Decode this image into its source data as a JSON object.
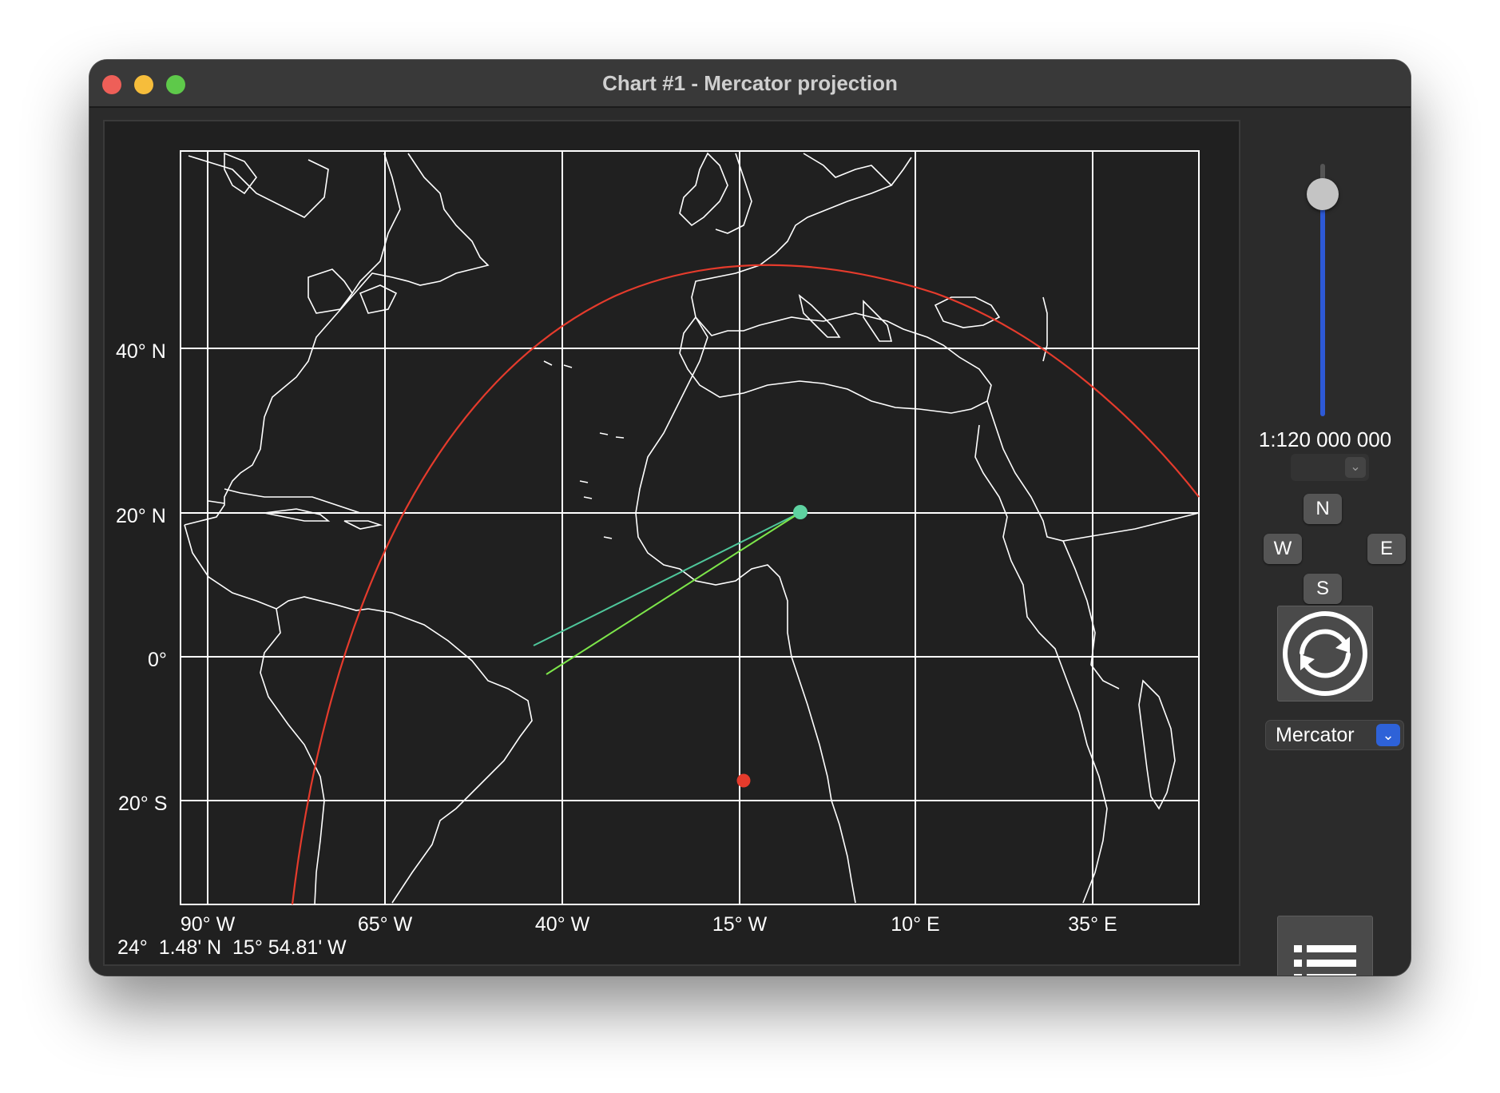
{
  "window": {
    "title": "Chart #1 - Mercator projection"
  },
  "map": {
    "projection": "Mercator",
    "lat_labels": [
      "40° N",
      "20° N",
      "0°",
      "20° S"
    ],
    "lon_labels": [
      "90° W",
      "65° W",
      "40° W",
      "15° W",
      "10° E",
      "35° E"
    ],
    "cursor_readout": "24°  1.48' N  15° 54.81' W",
    "colors": {
      "background": "#202020",
      "coastline": "#ffffff",
      "grid": "#ffffff",
      "great_circle": "#e53b2c",
      "track_teal": "#4fc79b",
      "track_green": "#7de64a",
      "point_red": "#e53b2c",
      "point_teal": "#5ed1a0"
    },
    "points": [
      {
        "name": "teal-point",
        "lat": 23,
        "lon": -4
      },
      {
        "name": "red-point",
        "lat": -15,
        "lon": -18
      }
    ]
  },
  "controls": {
    "scale": "1:120 000 000",
    "scale_select_value": "",
    "zoom_level": 0.88,
    "nav": {
      "north": "N",
      "west": "W",
      "east": "E",
      "south": "S"
    },
    "refresh_icon": "refresh-icon",
    "projection_select": "Mercator",
    "list_icon": "list-icon"
  }
}
